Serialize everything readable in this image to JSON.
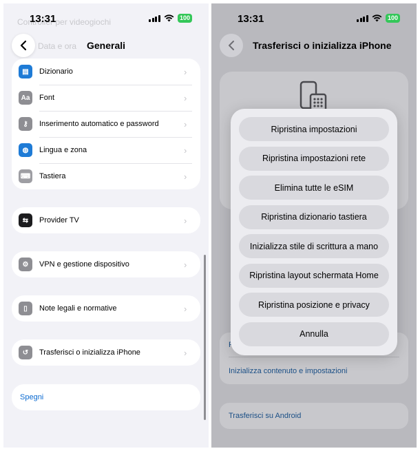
{
  "left": {
    "status": {
      "time": "13:31",
      "battery": "100"
    },
    "faded_top": "Controller per videogiochi",
    "faded_item": "Data e ora",
    "nav": {
      "title": "Generali"
    },
    "group1": [
      {
        "label": "Dizionario",
        "icon": "book-icon",
        "color": "#1e7bd6"
      },
      {
        "label": "Font",
        "icon": "font-icon",
        "color": "#8e8e93"
      },
      {
        "label": "Inserimento automatico e password",
        "icon": "key-icon",
        "color": "#8e8e93"
      },
      {
        "label": "Lingua e zona",
        "icon": "globe-icon",
        "color": "#1e7bd6"
      },
      {
        "label": "Tastiera",
        "icon": "keyboard-icon",
        "color": "#9e9ea3"
      }
    ],
    "provider": {
      "label": "Provider TV",
      "icon": "tv-provider-icon",
      "color": "#1c1c1e"
    },
    "vpn": {
      "label": "VPN e gestione dispositivo",
      "icon": "gear-icon",
      "color": "#8e8e93"
    },
    "legal": {
      "label": "Note legali e normative",
      "icon": "document-icon",
      "color": "#8e8e93"
    },
    "transfer": {
      "label": "Trasferisci o inizializza iPhone",
      "icon": "reset-icon",
      "color": "#8e8e93"
    },
    "shutdown": {
      "label": "Spegni"
    }
  },
  "right": {
    "status": {
      "time": "13:31",
      "battery": "100"
    },
    "nav": {
      "title": "Trasferisci o inizializza iPhone"
    },
    "bg_reset_partial": "R",
    "bg_erase": "Inizializza contenuto e impostazioni",
    "bg_android": "Trasferisci su Android",
    "menu": [
      "Ripristina impostazioni",
      "Ripristina impostazioni rete",
      "Elimina tutte le eSIM",
      "Ripristina dizionario tastiera",
      "Inizializza stile di scrittura a mano",
      "Ripristina layout schermata Home",
      "Ripristina posizione e privacy",
      "Annulla"
    ]
  },
  "colors": {
    "link": "#0a6ad1",
    "battery": "#34c759"
  }
}
